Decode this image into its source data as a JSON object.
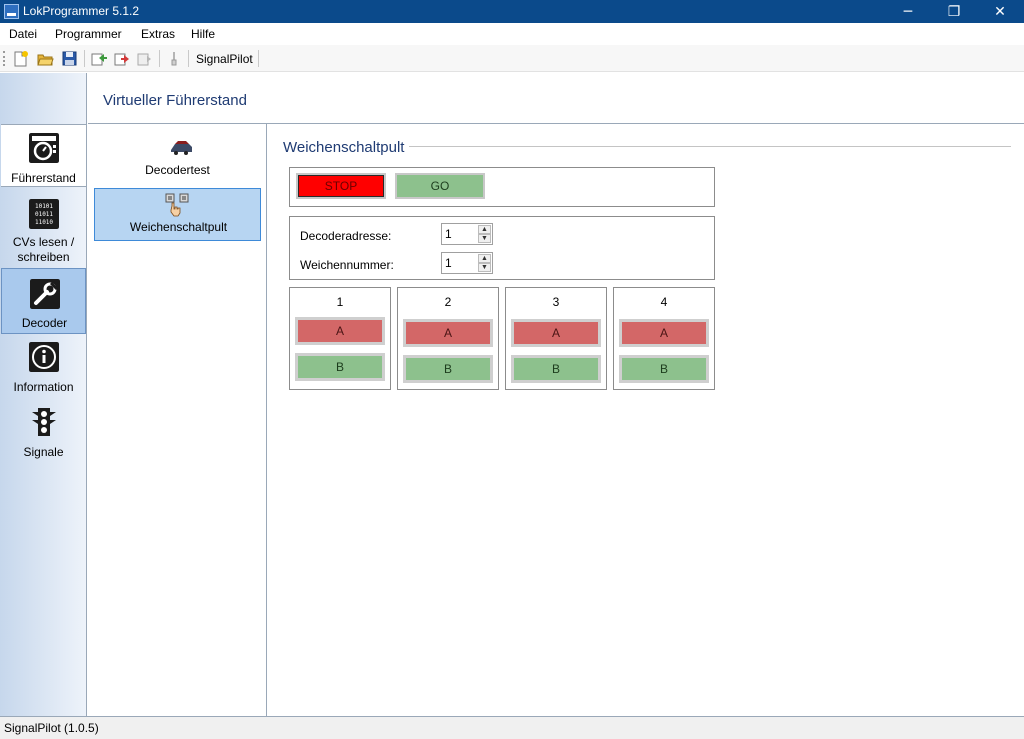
{
  "window": {
    "title": "LokProgrammer 5.1.2",
    "minimize_glyph": "─",
    "restore_glyph": "❐",
    "close_glyph": "✕"
  },
  "menu": {
    "items": [
      {
        "label": "Datei"
      },
      {
        "label": "Programmer"
      },
      {
        "label": "Extras"
      },
      {
        "label": "Hilfe"
      }
    ]
  },
  "toolbar": {
    "icons": [
      "new-file-icon",
      "open-folder-icon",
      "save-icon",
      "read-decoder-icon",
      "write-decoder-icon",
      "sound-icon",
      "tool-icon"
    ],
    "signalpilot_label": "SignalPilot"
  },
  "leftnav": {
    "items": [
      {
        "label": "Führerstand",
        "icon": "speedometer-icon",
        "state": "selected-white"
      },
      {
        "label": "CVs lesen / schreiben",
        "icon": "binary-icon",
        "state": "normal"
      },
      {
        "label": "Decoder",
        "icon": "wrench-icon",
        "state": "selected-blue"
      },
      {
        "label": "Information",
        "icon": "info-icon",
        "state": "normal"
      },
      {
        "label": "Signale",
        "icon": "traffic-light-icon",
        "state": "normal"
      }
    ]
  },
  "header": {
    "title": "Virtueller Führerstand"
  },
  "subnav": {
    "items": [
      {
        "label": "Decodertest",
        "icon": "locomotive-icon",
        "selected": false
      },
      {
        "label": "Weichenschaltpult",
        "icon": "hand-switch-icon",
        "selected": true
      }
    ]
  },
  "main": {
    "section_title": "Weichenschaltpult",
    "stop_label": "STOP",
    "go_label": "GO",
    "decoder_address_label": "Decoderadresse:",
    "decoder_address_value": "1",
    "switch_number_label": "Weichennummer:",
    "switch_number_value": "1",
    "switches": [
      {
        "number": "1",
        "a_label": "A",
        "b_label": "B"
      },
      {
        "number": "2",
        "a_label": "A",
        "b_label": "B"
      },
      {
        "number": "3",
        "a_label": "A",
        "b_label": "B"
      },
      {
        "number": "4",
        "a_label": "A",
        "b_label": "B"
      }
    ]
  },
  "colors": {
    "stop": "#ff0000",
    "go": "#8dc18d",
    "switch_a": "#d36767",
    "switch_b": "#8dc18d",
    "titlebar": "#0b4a8b",
    "accent_text": "#1f3b73"
  },
  "statusbar": {
    "text": "SignalPilot (1.0.5)"
  }
}
